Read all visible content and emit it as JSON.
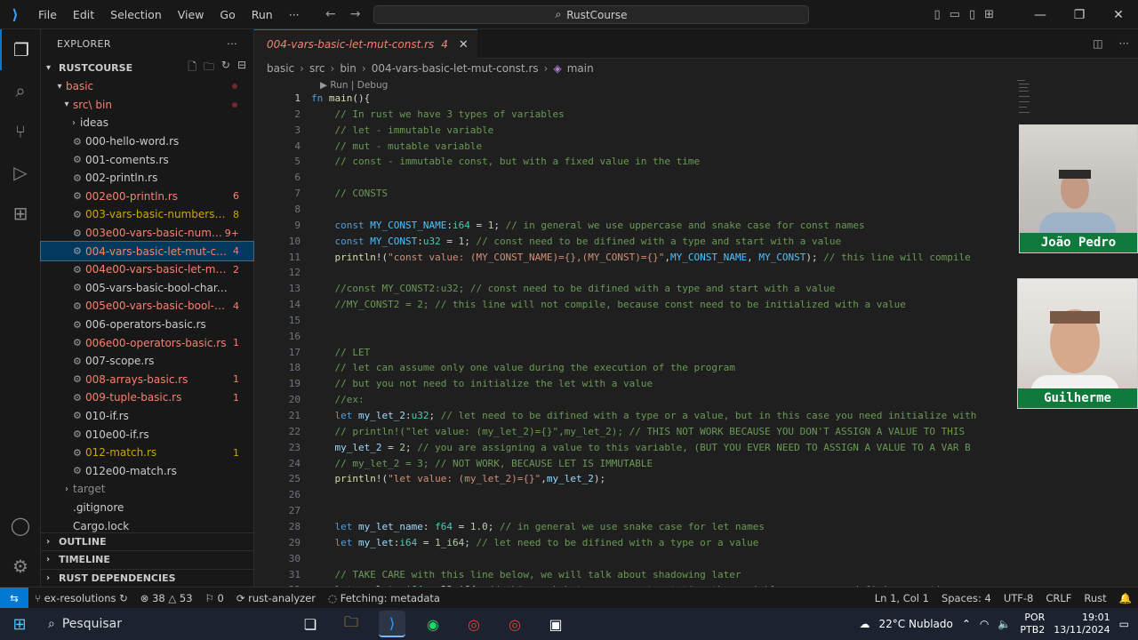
{
  "title_bar": {
    "menu": [
      "File",
      "Edit",
      "Selection",
      "View",
      "Go",
      "Run",
      "···"
    ],
    "search": "RustCourse"
  },
  "explorer": {
    "header": "EXPLORER",
    "root": "RUSTCOURSE",
    "folder_basic": "basic",
    "folder_src": "src\\ bin",
    "folder_ideas": "ideas",
    "files": [
      {
        "name": "000-hello-word.rs",
        "badge": "",
        "color": "normal"
      },
      {
        "name": "001-coments.rs",
        "badge": "",
        "color": "normal"
      },
      {
        "name": "002-println.rs",
        "badge": "",
        "color": "normal"
      },
      {
        "name": "002e00-println.rs",
        "badge": "6",
        "color": "red"
      },
      {
        "name": "003-vars-basic-numbers.rs",
        "badge": "8",
        "color": "yellow"
      },
      {
        "name": "003e00-vars-basic-numbers...",
        "badge": "9+",
        "color": "red"
      },
      {
        "name": "004-vars-basic-let-mut-const...",
        "badge": "4",
        "color": "red"
      },
      {
        "name": "004e00-vars-basic-let-mut-c...",
        "badge": "2",
        "color": "red"
      },
      {
        "name": "005-vars-basic-bool-char.rs",
        "badge": "",
        "color": "normal"
      },
      {
        "name": "005e00-vars-basic-bool-char...",
        "badge": "4",
        "color": "red"
      },
      {
        "name": "006-operators-basic.rs",
        "badge": "",
        "color": "normal"
      },
      {
        "name": "006e00-operators-basic.rs",
        "badge": "1",
        "color": "red"
      },
      {
        "name": "007-scope.rs",
        "badge": "",
        "color": "normal"
      },
      {
        "name": "008-arrays-basic.rs",
        "badge": "1",
        "color": "red"
      },
      {
        "name": "009-tuple-basic.rs",
        "badge": "1",
        "color": "red"
      },
      {
        "name": "010-if.rs",
        "badge": "",
        "color": "normal"
      },
      {
        "name": "010e00-if.rs",
        "badge": "",
        "color": "normal"
      },
      {
        "name": "012-match.rs",
        "badge": "1",
        "color": "yellow"
      },
      {
        "name": "012e00-match.rs",
        "badge": "",
        "color": "normal"
      }
    ],
    "folder_target": "target",
    "file_gitignore": ".gitignore",
    "file_cargo": "Cargo.lock",
    "sections": [
      "OUTLINE",
      "TIMELINE",
      "RUST DEPENDENCIES"
    ]
  },
  "editor": {
    "tab_label": "004-vars-basic-let-mut-const.rs",
    "tab_badge": "4",
    "breadcrumb": [
      "basic",
      "src",
      "bin",
      "004-vars-basic-let-mut-const.rs",
      "main"
    ],
    "codelens": "▶ Run | Debug",
    "lines": [
      "fn main(){",
      "    // In rust we have 3 types of variables",
      "    // let - immutable variable",
      "    // mut - mutable variable",
      "    // const - immutable const, but with a fixed value in the time",
      "",
      "    // CONSTS",
      "",
      "    const MY_CONST_NAME:i64 = 1; // in general we use uppercase and snake case for const names",
      "    const MY_CONST:u32 = 1; // const need to be difined with a type and start with a value",
      "    println!(\"const value: (MY_CONST_NAME)={},(MY_CONST)={}\",MY_CONST_NAME, MY_CONST); // this line will compile",
      "",
      "    //const MY_CONST2:u32; // const need to be difined with a type and start with a value",
      "    //MY_CONST2 = 2; // this line will not compile, because const need to be initialized with a value",
      "",
      "",
      "    // LET",
      "    // let can assume only one value during the execution of the program",
      "    // but you not need to initialize the let with a value",
      "    //ex:",
      "    let my_let_2:u32; // let need to be difined with a type or a value, but in this case you need initialize with",
      "    // println!(\"let value: (my_let_2)={}\",my_let_2); // THIS NOT WORK BECAUSE YOU DON'T ASSIGN A VALUE TO THIS",
      "    my_let_2 = 2; // you are assigning a value to this variable, (BUT YOU EVER NEED TO ASSIGN A VALUE TO A VAR B",
      "    // my_let_2 = 3; // NOT WORK, BECAUSE LET IS IMMUTABLE",
      "    println!(\"let value: (my_let_2)={}\",my_let_2);",
      "",
      "",
      "    let my_let_name: f64 = 1.0; // in general we use snake case for let names",
      "    let my_let:i64 = 1_i64; // let need to be difined with a type or a value",
      "",
      "    // TAKE CARE with this line below, we will talk about shadowing later",
      "    let my_let: i64 = 22_i64; // this work but you are not mutating the variable, you are redefining creating a"
    ]
  },
  "webcams": [
    {
      "name": "João Pedro"
    },
    {
      "name": "Guilherme"
    }
  ],
  "status_bar": {
    "branch": "ex-resolutions",
    "errors": "38",
    "warnings": "53",
    "info": "0",
    "analyzer": "rust-analyzer",
    "fetching": "Fetching: metadata",
    "position": "Ln 1, Col 1",
    "spaces": "Spaces: 4",
    "encoding": "UTF-8",
    "eol": "CRLF",
    "language": "Rust"
  },
  "taskbar": {
    "search": "Pesquisar",
    "weather": "22°C  Nublado",
    "lang1": "POR",
    "lang2": "PTB2",
    "time": "19:01",
    "date": "13/11/2024"
  }
}
